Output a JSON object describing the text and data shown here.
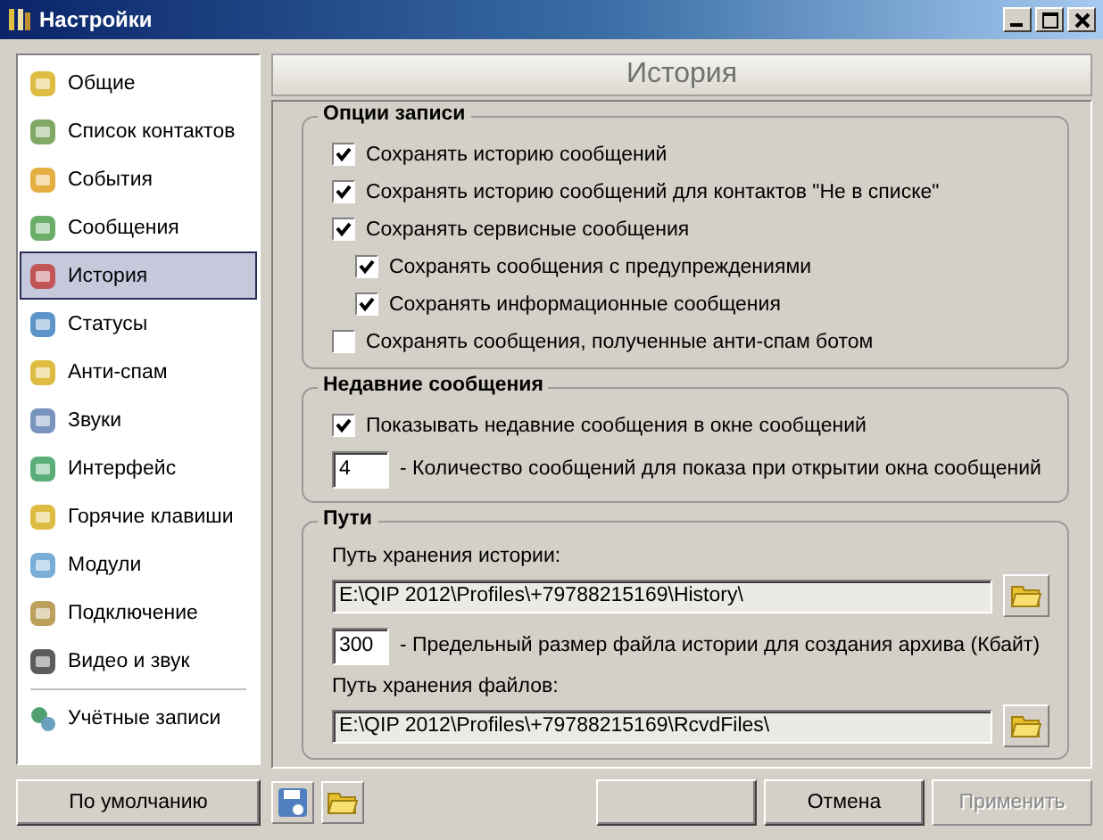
{
  "window": {
    "title": "Настройки"
  },
  "sidebar": {
    "items": [
      {
        "label": "Общие",
        "selected": false
      },
      {
        "label": "Список контактов",
        "selected": false
      },
      {
        "label": "События",
        "selected": false
      },
      {
        "label": "Сообщения",
        "selected": false
      },
      {
        "label": "История",
        "selected": true
      },
      {
        "label": "Статусы",
        "selected": false
      },
      {
        "label": "Анти-спам",
        "selected": false
      },
      {
        "label": "Звуки",
        "selected": false
      },
      {
        "label": "Интерфейс",
        "selected": false
      },
      {
        "label": "Горячие клавиши",
        "selected": false
      },
      {
        "label": "Модули",
        "selected": false
      },
      {
        "label": "Подключение",
        "selected": false
      },
      {
        "label": "Видео и звук",
        "selected": false
      }
    ],
    "bottom_items": [
      {
        "label": "Учётные записи",
        "selected": false
      }
    ],
    "default_button": "По умолчанию"
  },
  "page": {
    "title": "История",
    "groups": [
      {
        "title": "Опции записи",
        "rows": [
          {
            "kind": "checkbox",
            "label": "Сохранять историю сообщений",
            "checked": true,
            "nested": false
          },
          {
            "kind": "checkbox",
            "label": "Сохранять историю сообщений для контактов \"Не в списке\"",
            "checked": true,
            "nested": false
          },
          {
            "kind": "checkbox",
            "label": "Сохранять сервисные сообщения",
            "checked": true,
            "nested": false
          },
          {
            "kind": "checkbox",
            "label": "Сохранять сообщения с предупреждениями",
            "checked": true,
            "nested": true
          },
          {
            "kind": "checkbox",
            "label": "Сохранять информационные сообщения",
            "checked": true,
            "nested": true
          },
          {
            "kind": "checkbox",
            "label": "Сохранять сообщения, полученные анти-спам ботом",
            "checked": false,
            "nested": false
          }
        ]
      },
      {
        "title": "Недавние сообщения",
        "rows": [
          {
            "kind": "checkbox",
            "label": "Показывать недавние сообщения в окне сообщений",
            "checked": true,
            "nested": false
          },
          {
            "kind": "number",
            "value": "4",
            "label": "- Количество сообщений для показа при открытии окна сообщений"
          }
        ]
      },
      {
        "title": "Пути",
        "rows": [
          {
            "kind": "path",
            "label": "Путь хранения истории:",
            "value": "E:\\QIP 2012\\Profiles\\+79788215169\\History\\"
          },
          {
            "kind": "number",
            "value": "300",
            "label": "- Предельный размер файла истории для создания архива (Кбайт)"
          },
          {
            "kind": "path",
            "label": "Путь хранения файлов:",
            "value": "E:\\QIP 2012\\Profiles\\+79788215169\\RcvdFiles\\"
          }
        ]
      }
    ]
  },
  "buttons": [
    {
      "disabled": false
    },
    {
      "label": "Отмена",
      "disabled": false
    },
    {
      "label": "Применить",
      "disabled": true
    }
  ]
}
